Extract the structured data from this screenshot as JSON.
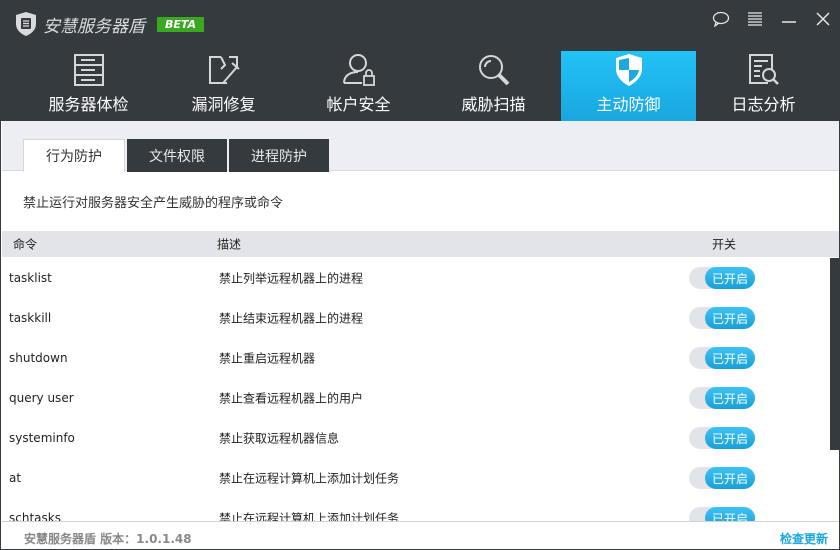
{
  "app": {
    "title": "安慧服务器盾",
    "badge": "BETA"
  },
  "nav": [
    {
      "label": "服务器体检",
      "icon": "server-icon"
    },
    {
      "label": "漏洞修复",
      "icon": "repair-icon"
    },
    {
      "label": "帐户安全",
      "icon": "user-lock-icon"
    },
    {
      "label": "威胁扫描",
      "icon": "search-icon"
    },
    {
      "label": "主动防御",
      "icon": "shield-icon",
      "active": true
    },
    {
      "label": "日志分析",
      "icon": "log-icon"
    }
  ],
  "tabs": [
    "行为防护",
    "文件权限",
    "进程防护"
  ],
  "description": "禁止运行对服务器安全产生威胁的程序或命令",
  "table": {
    "headers": [
      "命令",
      "描述",
      "开关"
    ],
    "rows": [
      {
        "cmd": "tasklist",
        "desc": "禁止列举远程机器上的进程",
        "state": "已开启"
      },
      {
        "cmd": "taskkill",
        "desc": "禁止结束远程机器上的进程",
        "state": "已开启"
      },
      {
        "cmd": "shutdown",
        "desc": "禁止重启远程机器",
        "state": "已开启"
      },
      {
        "cmd": "query user",
        "desc": "禁止查看远程机器上的用户",
        "state": "已开启"
      },
      {
        "cmd": "systeminfo",
        "desc": "禁止获取远程机器信息",
        "state": "已开启"
      },
      {
        "cmd": "at",
        "desc": "禁止在远程计算机上添加计划任务",
        "state": "已开启"
      },
      {
        "cmd": "schtasks",
        "desc": "禁止在远程计算机上添加计划任务",
        "state": "已开启"
      }
    ]
  },
  "footer": {
    "version": "安慧服务器盾 版本：1.0.1.48",
    "update": "检查更新"
  },
  "colors": {
    "accent": "#1aa6df",
    "dark": "#353a3f",
    "beta": "#3aa820"
  }
}
